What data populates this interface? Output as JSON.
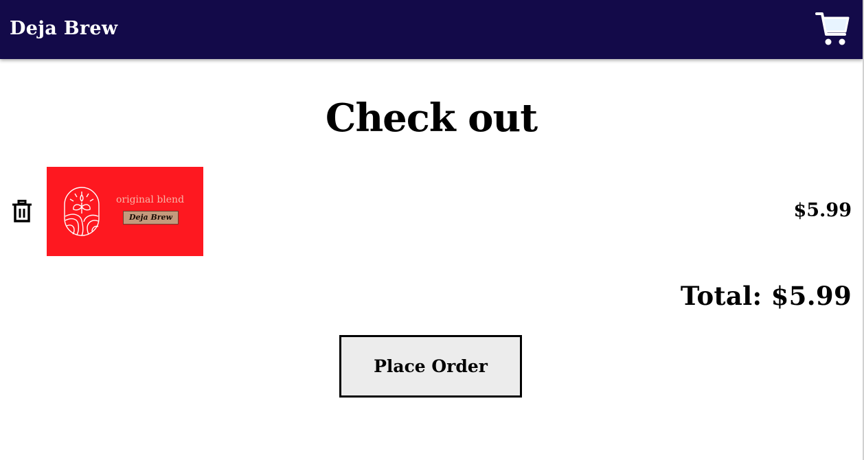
{
  "header": {
    "brand": "Deja Brew",
    "cart_icon": "shopping-cart-icon",
    "background_color": "#130a49"
  },
  "page": {
    "title": "Check out"
  },
  "cart_items": [
    {
      "remove_icon": "trash-icon",
      "image_text": "original blend",
      "image_label": "Deja Brew",
      "image_color": "#fe1820",
      "price": "$5.99"
    }
  ],
  "summary": {
    "total": "Total: $5.99"
  },
  "actions": {
    "place_order_label": "Place Order"
  }
}
